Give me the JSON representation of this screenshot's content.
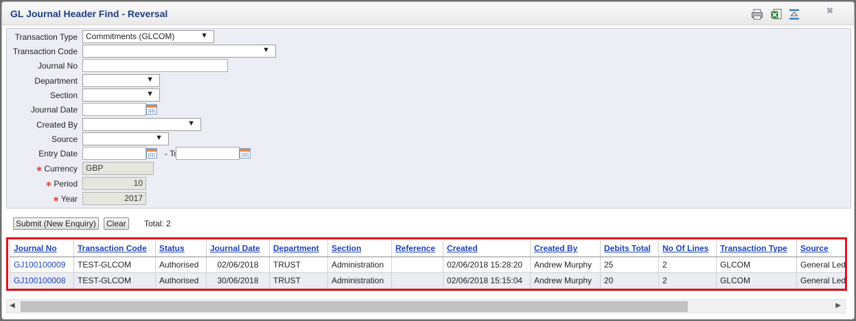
{
  "window": {
    "title": "GL Journal Header Find - Reversal"
  },
  "toolbar": {
    "print_icon": "printer-icon",
    "excel_icon": "excel-export-icon",
    "collapse_icon": "collapse-panel-icon",
    "close_glyph": "✖"
  },
  "form": {
    "transaction_type": {
      "label": "Transaction Type",
      "value": "Commitments (GLCOM)"
    },
    "transaction_code": {
      "label": "Transaction Code",
      "value": ""
    },
    "journal_no": {
      "label": "Journal No",
      "value": ""
    },
    "department": {
      "label": "Department",
      "value": ""
    },
    "section": {
      "label": "Section",
      "value": ""
    },
    "journal_date": {
      "label": "Journal Date",
      "value": ""
    },
    "created_by": {
      "label": "Created By",
      "value": ""
    },
    "source": {
      "label": "Source",
      "value": ""
    },
    "entry_date": {
      "label": "Entry Date",
      "from": "",
      "to_label": "- To",
      "to": ""
    },
    "currency": {
      "label": "Currency",
      "value": "GBP",
      "required_mark": "✱"
    },
    "period": {
      "label": "Period",
      "value": "10",
      "required_mark": "✱"
    },
    "year": {
      "label": "Year",
      "value": "2017",
      "required_mark": "✱"
    },
    "dropdown_arrow": "▼"
  },
  "actions": {
    "submit_label": "Submit (New Enquiry)",
    "clear_label": "Clear",
    "total_text": "Total: 2"
  },
  "grid": {
    "columns": [
      "Journal No",
      "Transaction Code",
      "Status",
      "Journal Date",
      "Department",
      "Section",
      "Reference",
      "Created",
      "Created By",
      "Debits Total",
      "No Of Lines",
      "Transaction Type",
      "Source"
    ],
    "rows": [
      [
        "GJ100100009",
        "TEST-GLCOM",
        "Authorised",
        "02/06/2018",
        "TRUST",
        "Administration",
        "",
        "02/06/2018 15:28:20",
        "Andrew Murphy",
        "25",
        "2",
        "GLCOM",
        "General Ledger"
      ],
      [
        "GJ100100008",
        "TEST-GLCOM",
        "Authorised",
        "30/06/2018",
        "TRUST",
        "Administration",
        "",
        "02/06/2018 15:15:04",
        "Andrew Murphy",
        "20",
        "2",
        "GLCOM",
        "General Ledger"
      ]
    ]
  },
  "colors": {
    "accent": "#1d3d84",
    "link": "#1d43b8",
    "highlight_border": "#e3101b",
    "panel_bg": "#ededf5"
  }
}
